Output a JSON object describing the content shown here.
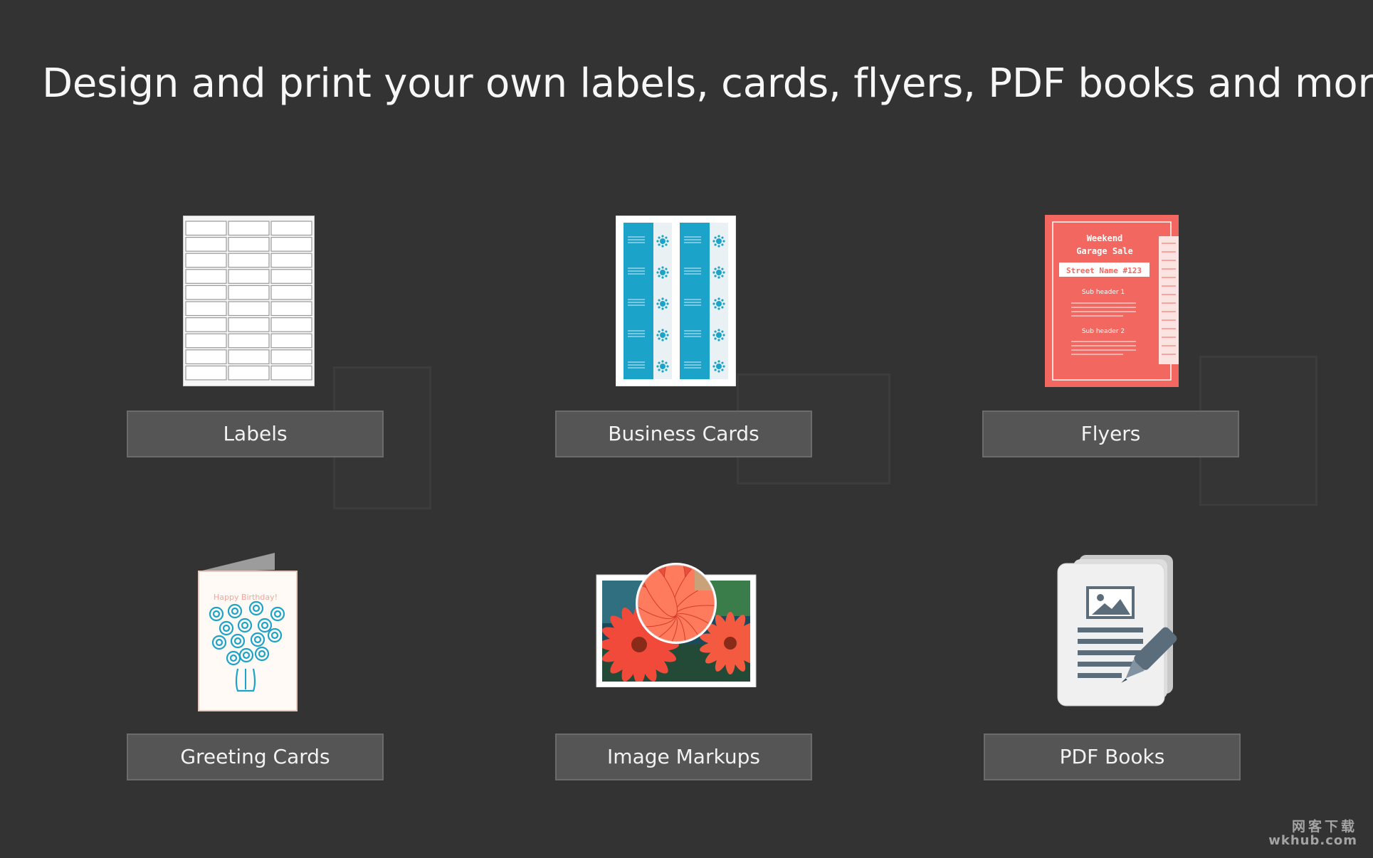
{
  "header": {
    "title": "Design and print your own labels, cards, flyers, PDF books and more!"
  },
  "categories": [
    {
      "id": "labels",
      "label": "Labels",
      "icon": "label-sheet-icon"
    },
    {
      "id": "business-cards",
      "label": "Business Cards",
      "icon": "business-card-sheet-icon"
    },
    {
      "id": "flyers",
      "label": "Flyers",
      "icon": "flyer-icon"
    },
    {
      "id": "greeting-cards",
      "label": "Greeting Cards",
      "icon": "greeting-card-icon"
    },
    {
      "id": "image-markups",
      "label": "Image Markups",
      "icon": "image-markup-icon"
    },
    {
      "id": "pdf-books",
      "label": "PDF Books",
      "icon": "pdf-book-icon"
    }
  ],
  "flyer_preview": {
    "line1": "Weekend",
    "line2": "Garage Sale",
    "banner": "Street Name #123",
    "sub1": "Sub header 1",
    "sub2": "Sub header 2"
  },
  "greeting_preview": {
    "text": "Happy Birthday!"
  },
  "watermark": {
    "cn": "网客下载",
    "en": "wkhub.com"
  },
  "colors": {
    "background": "#333333",
    "button": "#555555",
    "button_border": "#6b6b6b",
    "card_blue": "#1ca3c9",
    "flyer_red": "#f2675f"
  }
}
